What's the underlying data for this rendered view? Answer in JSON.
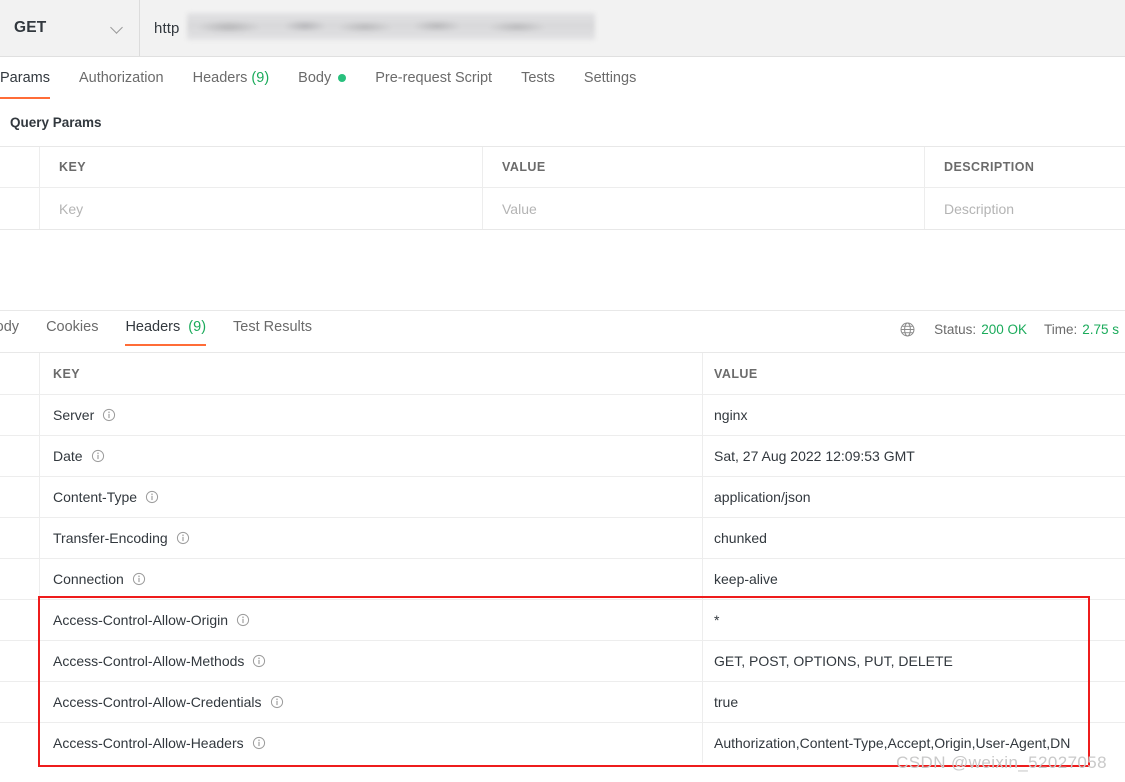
{
  "request_bar": {
    "method": "GET",
    "method_icon": "chevron-down-icon",
    "url_protocol": "http",
    "url_redacted": true
  },
  "request_tabs": [
    {
      "label": "Params",
      "active": true,
      "badge": "",
      "dot": false
    },
    {
      "label": "Authorization",
      "active": false,
      "badge": "",
      "dot": false
    },
    {
      "label": "Headers",
      "active": false,
      "badge": "(9)",
      "dot": false
    },
    {
      "label": "Body",
      "active": false,
      "badge": "",
      "dot": true
    },
    {
      "label": "Pre-request Script",
      "active": false,
      "badge": "",
      "dot": false
    },
    {
      "label": "Tests",
      "active": false,
      "badge": "",
      "dot": false
    },
    {
      "label": "Settings",
      "active": false,
      "badge": "",
      "dot": false
    }
  ],
  "query_params": {
    "title": "Query Params",
    "columns": [
      "KEY",
      "VALUE",
      "DESCRIPTION"
    ],
    "input_row": {
      "key_placeholder": "Key",
      "value_placeholder": "Value",
      "description_placeholder": "Description"
    }
  },
  "response_tabs": [
    {
      "label": "Body",
      "active": false,
      "badge": ""
    },
    {
      "label": "Cookies",
      "active": false,
      "badge": ""
    },
    {
      "label": "Headers",
      "active": true,
      "badge": "(9)"
    },
    {
      "label": "Test Results",
      "active": false,
      "badge": ""
    }
  ],
  "response_meta": {
    "globe_icon": "globe-icon",
    "status_label": "Status:",
    "status_value": "200 OK",
    "time_label": "Time:",
    "time_value": "2.75 s"
  },
  "response_headers": {
    "columns": [
      "KEY",
      "VALUE"
    ],
    "rows": [
      {
        "key": "Server",
        "value": "nginx",
        "highlighted": false
      },
      {
        "key": "Date",
        "value": "Sat, 27 Aug 2022 12:09:53 GMT",
        "highlighted": false
      },
      {
        "key": "Content-Type",
        "value": "application/json",
        "highlighted": false
      },
      {
        "key": "Transfer-Encoding",
        "value": "chunked",
        "highlighted": false
      },
      {
        "key": "Connection",
        "value": "keep-alive",
        "highlighted": false
      },
      {
        "key": "Access-Control-Allow-Origin",
        "value": "*",
        "highlighted": true
      },
      {
        "key": "Access-Control-Allow-Methods",
        "value": "GET, POST, OPTIONS, PUT, DELETE",
        "highlighted": true
      },
      {
        "key": "Access-Control-Allow-Credentials",
        "value": "true",
        "highlighted": true
      },
      {
        "key": "Access-Control-Allow-Headers",
        "value": "Authorization,Content-Type,Accept,Origin,User-Agent,DN",
        "highlighted": true
      }
    ]
  },
  "highlight": {
    "color": "#ee1c1c"
  },
  "watermark": {
    "text": "CSDN @weixin_52027058"
  },
  "colors": {
    "accent": "#ff6c37",
    "success_green": "#1bab5b",
    "dot_green": "#28c07d",
    "highlight_red": "#ee1c1c",
    "text_dark": "#32383e",
    "text_muted": "#6b6b6b"
  }
}
